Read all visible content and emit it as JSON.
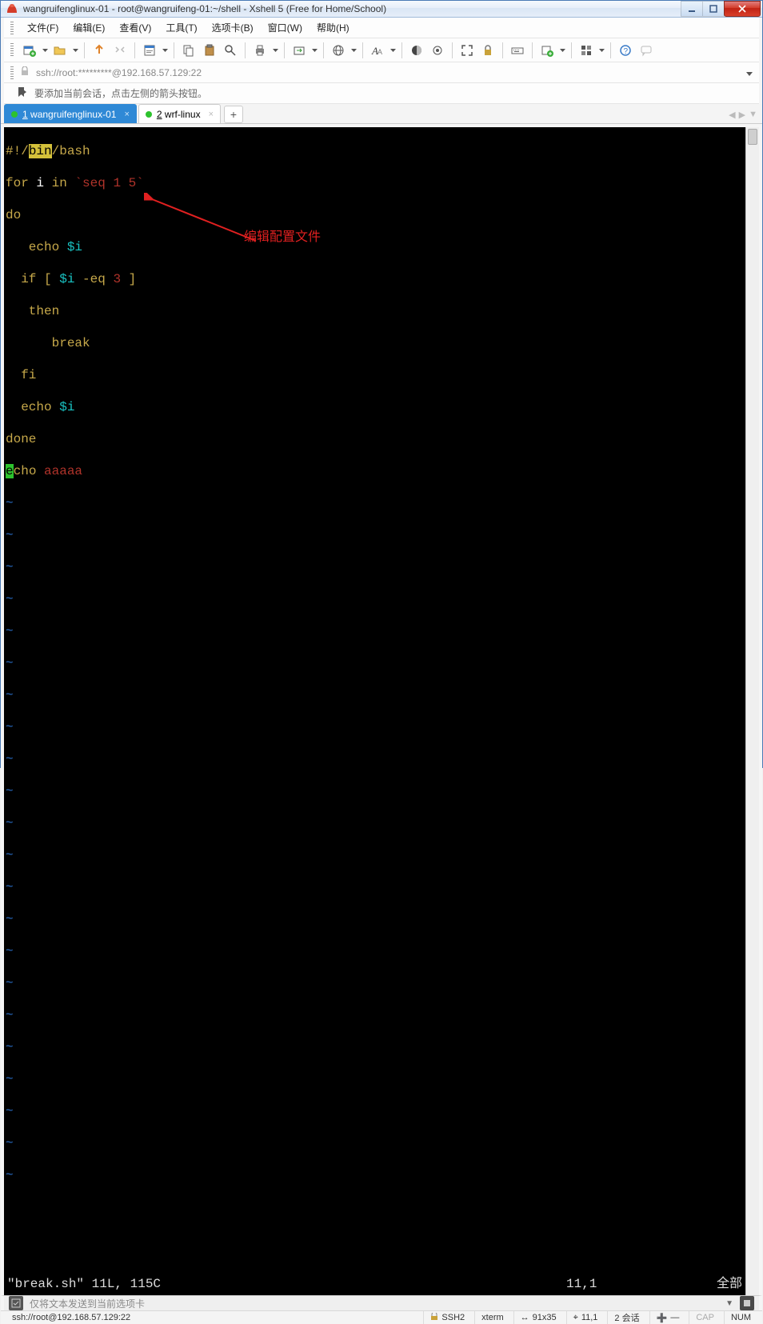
{
  "window": {
    "title": "wangruifenglinux-01 - root@wangruifeng-01:~/shell - Xshell 5 (Free for Home/School)"
  },
  "menus": [
    "文件(F)",
    "编辑(E)",
    "查看(V)",
    "工具(T)",
    "选项卡(B)",
    "窗口(W)",
    "帮助(H)"
  ],
  "address": "ssh://root:*********@192.168.57.129:22",
  "hint": "要添加当前会话，点击左侧的箭头按钮。",
  "tabs": {
    "items": [
      {
        "label": "1 wangruifenglinux-01",
        "active": true,
        "dot": "#2dc22d"
      },
      {
        "label": "2 wrf-linux",
        "active": false,
        "dot": "#2dc22d"
      }
    ],
    "add": "+"
  },
  "code": {
    "l1_a": "#!/",
    "l1_b": "bin",
    "l1_c": "/bash",
    "l2_a": "for",
    "l2_b": " i ",
    "l2_c": "in",
    "l2_d": " `seq ",
    "l2_e": "1 5",
    "l2_f": "`",
    "l3": "do",
    "l4_a": "   echo ",
    "l4_b": "$i",
    "l5_a": "  if ",
    "l5_b": "[ ",
    "l5_c": "$i ",
    "l5_d": "-eq ",
    "l5_e": "3 ",
    "l5_f": "]",
    "l6": "   then",
    "l7": "      break",
    "l8": "  fi",
    "l9_a": "  echo ",
    "l9_b": "$i",
    "l10": "done",
    "l11_a": "e",
    "l11_b": "cho ",
    "l11_c": "aaaaa",
    "tilde": "~"
  },
  "annotation": "编辑配置文件",
  "vim": {
    "file": "\"break.sh\" 11L, 115C",
    "pos": "11,1",
    "pct": "全部"
  },
  "sendbar_placeholder": "仅将文本发送到当前选项卡",
  "status": {
    "conn": "ssh://root@192.168.57.129:22",
    "proto": "SSH2",
    "term": "xterm",
    "size": "91x35",
    "cursor": "11,1",
    "sessions": "2 会话",
    "cap": "CAP",
    "num": "NUM"
  }
}
